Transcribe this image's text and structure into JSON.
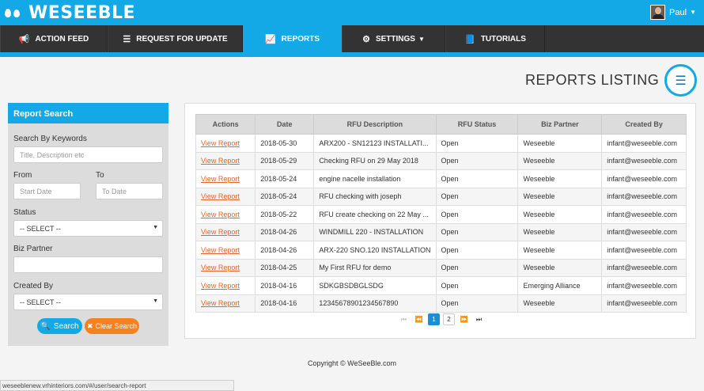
{
  "brand": {
    "name": "WESEEBLE"
  },
  "user": {
    "name": "Paul"
  },
  "nav": {
    "items": [
      {
        "label": "ACTION FEED",
        "icon": "megaphone-icon"
      },
      {
        "label": "REQUEST FOR UPDATE",
        "icon": "list-icon"
      },
      {
        "label": "REPORTS",
        "icon": "area-chart-icon"
      },
      {
        "label": "SETTINGS",
        "icon": "gear-icon"
      },
      {
        "label": "TUTORIALS",
        "icon": "book-icon"
      }
    ],
    "active": "REPORTS"
  },
  "page": {
    "title": "REPORTS LISTING"
  },
  "search": {
    "header": "Report Search",
    "keywords_label": "Search By Keywords",
    "keywords_placeholder": "Title, Description etc",
    "from_label": "From",
    "to_label": "To",
    "from_placeholder": "Start Date",
    "to_placeholder": "To Date",
    "status_label": "Status",
    "status_value": "-- SELECT --",
    "biz_partner_label": "Biz Partner",
    "created_by_label": "Created By",
    "created_by_value": "-- SELECT --",
    "search_button": "Search",
    "clear_button": "Clear Search"
  },
  "table": {
    "columns": [
      "Actions",
      "Date",
      "RFU Description",
      "RFU Status",
      "Biz Partner",
      "Created By"
    ],
    "rows": [
      {
        "action": "View Report",
        "date": "2018-05-30",
        "description": "ARX200 - SN12123 INSTALLATI...",
        "status": "Open",
        "partner": "Weseeble",
        "created_by": "infant@weseeble.com"
      },
      {
        "action": "View Report",
        "date": "2018-05-29",
        "description": "Checking RFU on 29 May 2018",
        "status": "Open",
        "partner": "Weseeble",
        "created_by": "infant@weseeble.com"
      },
      {
        "action": "View Report",
        "date": "2018-05-24",
        "description": "engine nacelle installation",
        "status": "Open",
        "partner": "Weseeble",
        "created_by": "infant@weseeble.com"
      },
      {
        "action": "View Report",
        "date": "2018-05-24",
        "description": "RFU checking with joseph",
        "status": "Open",
        "partner": "Weseeble",
        "created_by": "infant@weseeble.com"
      },
      {
        "action": "View Report",
        "date": "2018-05-22",
        "description": "RFU create checking on 22 May ...",
        "status": "Open",
        "partner": "Weseeble",
        "created_by": "infant@weseeble.com"
      },
      {
        "action": "View Report",
        "date": "2018-04-26",
        "description": "WINDMILL 220 - INSTALLATION",
        "status": "Open",
        "partner": "Weseeble",
        "created_by": "infant@weseeble.com"
      },
      {
        "action": "View Report",
        "date": "2018-04-26",
        "description": "ARX-220 SNO.120 INSTALLATION",
        "status": "Open",
        "partner": "Weseeble",
        "created_by": "infant@weseeble.com"
      },
      {
        "action": "View Report",
        "date": "2018-04-25",
        "description": "My First RFU for demo",
        "status": "Open",
        "partner": "Weseeble",
        "created_by": "infant@weseeble.com"
      },
      {
        "action": "View Report",
        "date": "2018-04-16",
        "description": "SDKGBSDBGLSDG",
        "status": "Open",
        "partner": "Emerging Alliance",
        "created_by": "infant@weseeble.com"
      },
      {
        "action": "View Report",
        "date": "2018-04-16",
        "description": "12345678901234567890",
        "status": "Open",
        "partner": "Weseeble",
        "created_by": "infant@weseeble.com"
      }
    ]
  },
  "pagination": {
    "pages": [
      "1",
      "2"
    ],
    "current": "1"
  },
  "footer": {
    "copyright": "Copyright © WeSeeBle.com"
  },
  "statusbar": {
    "url": "weseeblenew.vrhinteriors.com/#/user/search-report"
  },
  "colors": {
    "primary": "#12a9e6",
    "nav_bg": "#333333",
    "link": "#e8632b",
    "clear_button": "#f5821f"
  }
}
